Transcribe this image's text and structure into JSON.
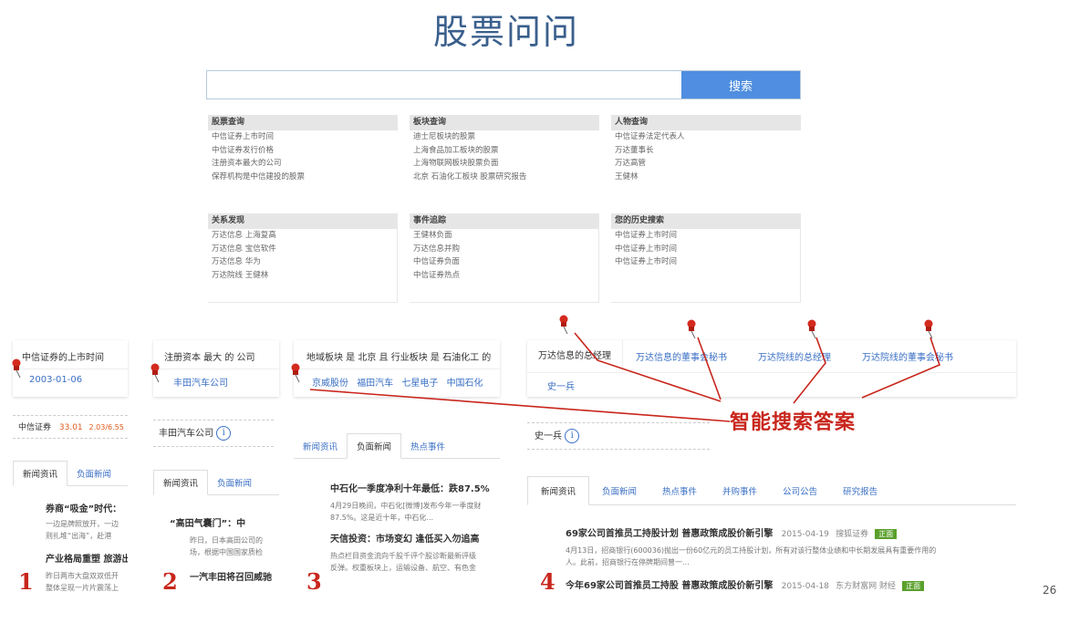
{
  "logo": "股票问问",
  "search": {
    "placeholder": "",
    "button": "搜索"
  },
  "query_sections": [
    {
      "title": "股票查询",
      "items": [
        "中信证券上市时间",
        "中信证券发行价格",
        "注册资本最大的公司",
        "保荐机构是中信建投的股票"
      ]
    },
    {
      "title": "板块查询",
      "items": [
        "迪士尼板块的股票",
        "上海食品加工板块的股票",
        "上海物联网板块股票负面",
        "北京 石油化工板块 股票研究报告"
      ]
    },
    {
      "title": "人物查询",
      "items": [
        "中信证券法定代表人",
        "万达董事长",
        "万达高管",
        "王健林"
      ]
    },
    {
      "title": "关系发现",
      "items": [
        "万达信息 上海复高",
        "万达信息 宝信软件",
        "万达信息 华为",
        "万达院线 王健林"
      ]
    },
    {
      "title": "事件追踪",
      "items": [
        "王健林负面",
        "万达信息并购",
        "中信证券负面",
        "中信证券热点"
      ]
    },
    {
      "title": "您的历史搜索",
      "items": [
        "中信证券上市时间",
        "中信证券上市时间",
        "中信证券上市时间"
      ]
    }
  ],
  "card1": {
    "title": "中信证券的上市时间",
    "value": "2003-01-06",
    "stock": "中信证券",
    "price": "33.01",
    "change": "2.03/6.55",
    "tabs": [
      "新闻资讯",
      "负面新闻"
    ],
    "head1": "券商“吸金”时代：",
    "line1": "一边是牌照放开，一边",
    "line2": "则扎堆“出海”，赴港",
    "head2": "产业格局重塑 旅游出",
    "line3": "昨日两市大盘双双低开",
    "line4": "整体呈现一片片震荡上",
    "num": "1"
  },
  "card2": {
    "title": "注册资本 最大 的 公司",
    "value": "丰田汽车公司",
    "company": "丰田汽车公司",
    "tabs": [
      "新闻资讯",
      "负面新闻"
    ],
    "head1": "“高田气囊门”：中",
    "line1": "昨日，日本高田公司的",
    "line2": "场，根据中国国家质检",
    "head2": "一汽丰田将召回威驰",
    "num": "2"
  },
  "card3": {
    "title": "地域板块 是 北京 且 行业板块 是 石油化工 的",
    "values": [
      "京威股份",
      "福田汽车",
      "七星电子",
      "中国石化"
    ],
    "tabs": [
      "新闻资讯",
      "负面新闻",
      "热点事件"
    ],
    "head1": "中石化一季度净利十年最低：跌87.5%",
    "line1": "4月29日晚间，中石化[微博]发布今年一季度财",
    "line2": "87.5%。这是近十年，中石化...",
    "head2": "天信投资：市场变幻 逢低买入勿追高",
    "line3": "热点栏目资金流向千股千评个股诊断最新评级",
    "line4": "反弹。权重板块上，运输设备、航空、有色金",
    "num": "3"
  },
  "card4": {
    "title": "万达信息的总经理",
    "others": [
      "万达信息的董事会秘书",
      "万达院线的总经理",
      "万达院线的董事会秘书"
    ],
    "value": "史一兵",
    "person": "史一兵",
    "tabs": [
      "新闻资讯",
      "负面新闻",
      "热点事件",
      "并购事件",
      "公司公告",
      "研究报告"
    ],
    "news1_title": "69家公司首推员工持股计划 普惠政策成股价新引擎",
    "news1_date": "2015-04-19",
    "news1_source": "搜狐证券",
    "news1_badge": "正面",
    "news1_line1": "4月13日，招商银行(600036)抛出一份60亿元的员工持股计划，所有对该行整体业绩和中长期发展具有重要作用的",
    "news1_line2": "人。此前，招商银行在停牌期间曾一...",
    "news2_title": "今年69家公司首推员工持股 普惠政策成股价新引擎",
    "news2_date": "2015-04-18",
    "news2_source": "东方财富网 财经",
    "news2_badge": "正面",
    "num": "4"
  },
  "annotation": "智能搜索答案",
  "page_number": "26",
  "colors": {
    "accent": "#4f8ee0",
    "annotation": "#c8261c",
    "link": "#3a6fc4"
  }
}
